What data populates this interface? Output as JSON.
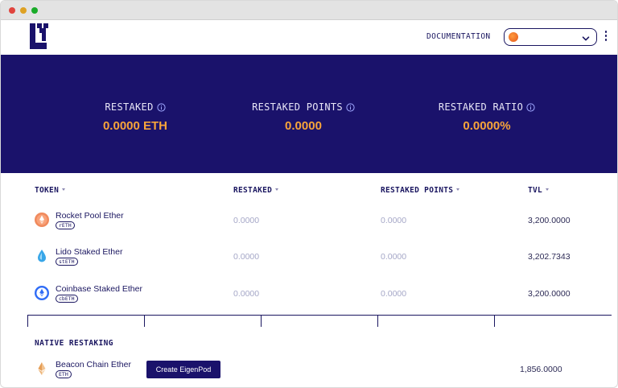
{
  "header": {
    "documentation_label": "DOCUMENTATION",
    "logo_icon": "eigenlayer-logo",
    "wallet_select": {
      "avatar_icon": "wallet-avatar-icon",
      "value": ""
    },
    "menu_icon": "kebab-menu-icon"
  },
  "stats": [
    {
      "label": "RESTAKED",
      "value": "0.0000 ETH"
    },
    {
      "label": "RESTAKED POINTS",
      "value": "0.0000"
    },
    {
      "label": "RESTAKED RATIO",
      "value": "0.0000%"
    }
  ],
  "table": {
    "columns": [
      "TOKEN",
      "RESTAKED",
      "RESTAKED POINTS",
      "TVL"
    ],
    "rows": [
      {
        "name": "Rocket Pool Ether",
        "symbol": "rETH",
        "restaked": "0.0000",
        "points": "0.0000",
        "tvl": "3,200.0000",
        "icon": "rocket-pool-icon"
      },
      {
        "name": "Lido Staked Ether",
        "symbol": "stETH",
        "restaked": "0.0000",
        "points": "0.0000",
        "tvl": "3,202.7343",
        "icon": "lido-icon"
      },
      {
        "name": "Coinbase Staked Ether",
        "symbol": "cbETH",
        "restaked": "0.0000",
        "points": "0.0000",
        "tvl": "3,200.0000",
        "icon": "coinbase-icon"
      }
    ]
  },
  "native": {
    "title": "NATIVE RESTAKING",
    "name": "Beacon Chain Ether",
    "symbol": "ETH",
    "button_label": "Create EigenPod",
    "tvl": "1,856.0000",
    "icon": "ethereum-icon"
  },
  "colors": {
    "brand_navy": "#1a126b",
    "accent_orange": "#f7a43a",
    "muted_value": "#a5a7c7"
  }
}
